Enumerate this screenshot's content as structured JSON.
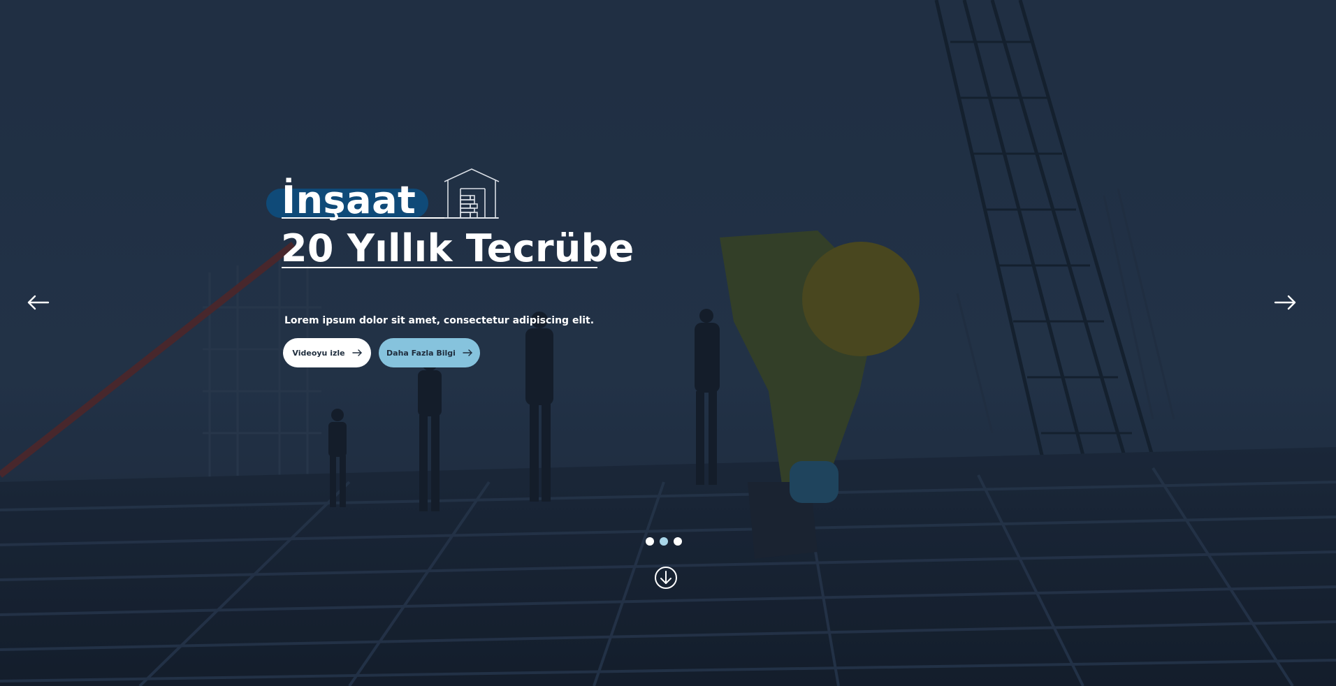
{
  "hero": {
    "title_line1": "İnşaat",
    "title_line2": "20 Yıllık Tecrübe",
    "subtitle": "Lorem ipsum dolor sit amet, consectetur adipiscing elit.",
    "buttons": {
      "video_label": "Videoyu izle",
      "more_label": "Daha Fazla Bilgi"
    }
  },
  "slider": {
    "slide_count": 3,
    "active_index": 1
  },
  "icons": {
    "prev": "arrow-left-icon",
    "next": "arrow-right-icon",
    "scroll": "circle-arrow-down-icon",
    "title_decoration": "house-icon"
  },
  "colors": {
    "accent_pill": "#0f4a78",
    "button_primary": "#ffffff",
    "button_secondary": "#86c3dd",
    "dot_active": "#a9d6ea",
    "text": "#ffffff"
  }
}
